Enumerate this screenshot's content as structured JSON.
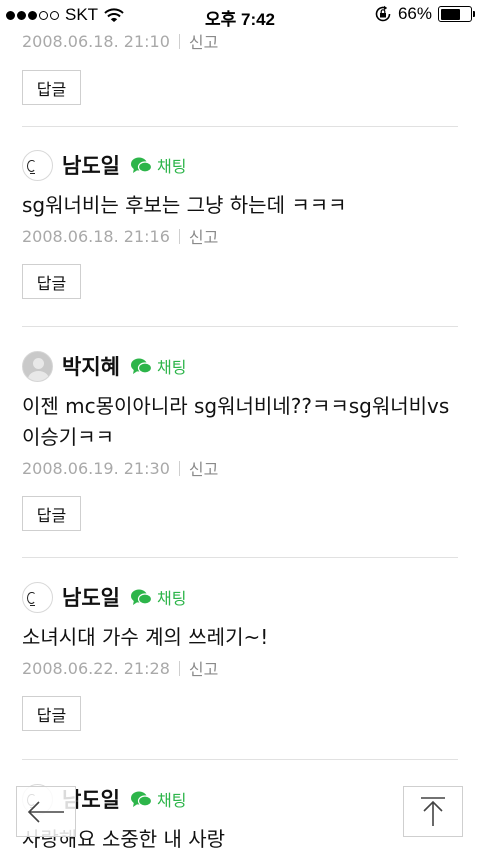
{
  "status_bar": {
    "carrier": "SKT",
    "time": "오후 7:42",
    "battery": "66%",
    "battery_level": 0.66
  },
  "first_comment": {
    "date": "2008.06.18. 21:10",
    "report": "신고",
    "reply": "답글"
  },
  "comments": [
    {
      "author": "남도일",
      "chat": "채팅",
      "text": "sg워너비는 후보는 그냥 하는데 ㅋㅋㅋ",
      "date": "2008.06.18. 21:16",
      "report": "신고",
      "reply": "답글"
    },
    {
      "author": "박지혜",
      "chat": "채팅",
      "text": "이젠 mc몽이아니라 sg워너비네??ㅋㅋsg워너비vs이승기ㅋㅋ",
      "date": "2008.06.19. 21:30",
      "report": "신고",
      "reply": "답글"
    },
    {
      "author": "남도일",
      "chat": "채팅",
      "text": "소녀시대 가수 계의 쓰레기~!",
      "date": "2008.06.22. 21:28",
      "report": "신고",
      "reply": "답글"
    },
    {
      "author": "남도일",
      "chat": "채팅",
      "text": "사랑해요 소중한 내 사랑"
    }
  ],
  "colors": {
    "chat_green": "#2db54a",
    "meta_grey": "#a9a9a9",
    "divider": "#e1e1e1"
  },
  "icons": {
    "back": "arrow-left-icon",
    "top": "arrow-up-to-top-icon",
    "chat": "speech-bubble-icon"
  }
}
